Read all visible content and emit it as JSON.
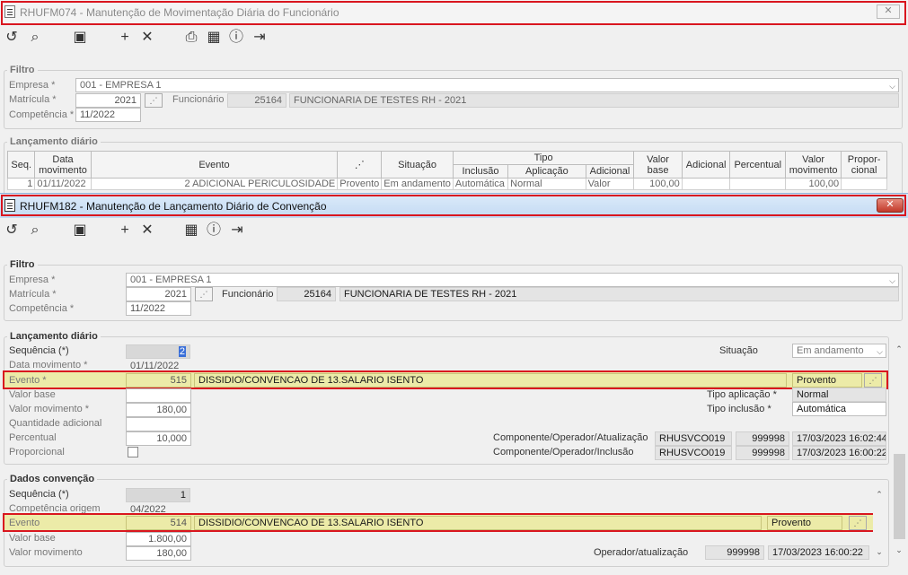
{
  "window1": {
    "title": "RHUFM074 - Manutenção de Movimentação Diária do Funcionário",
    "filtro": {
      "legend": "Filtro",
      "empresa_label": "Empresa *",
      "empresa_value": "001 - EMPRESA 1",
      "matricula_label": "Matrícula *",
      "matricula_value": "2021",
      "funcionario_label": "Funcionário",
      "funcionario_id": "25164",
      "funcionario_nome": "FUNCIONARIA DE TESTES RH - 2021",
      "competencia_label": "Competência *",
      "competencia_value": "11/2022"
    },
    "lancamento": {
      "legend": "Lançamento diário",
      "headers": {
        "seq": "Seq.",
        "data": "Data movimento",
        "evento": "Evento",
        "situacao": "Situação",
        "tipo": "Tipo",
        "inclusao": "Inclusão",
        "aplicacao": "Aplicação",
        "adicional": "Adicional",
        "valor_base": "Valor base",
        "adicional2": "Adicional",
        "percentual": "Percentual",
        "valor_mov": "Valor movimento",
        "proporcional": "Propor-cional"
      },
      "row": {
        "seq": "1",
        "data": "01/11/2022",
        "evento_cod": "2",
        "evento_nome": "ADICIONAL PERICULOSIDADE",
        "tipo_evento": "Provento",
        "situacao": "Em andamento",
        "inclusao": "Automática",
        "aplicacao": "Normal",
        "adicional": "Valor",
        "valor_base": "100,00",
        "valor_mov": "100,00"
      }
    }
  },
  "window2": {
    "title": "RHUFM182 - Manutenção de Lançamento Diário de Convenção",
    "filtro": {
      "legend": "Filtro",
      "empresa_label": "Empresa *",
      "empresa_value": "001 - EMPRESA 1",
      "matricula_label": "Matrícula *",
      "matricula_value": "2021",
      "funcionario_label": "Funcionário",
      "funcionario_id": "25164",
      "funcionario_nome": "FUNCIONARIA DE TESTES RH - 2021",
      "competencia_label": "Competência *",
      "competencia_value": "11/2022"
    },
    "lancamento": {
      "legend": "Lançamento diário",
      "sequencia_label": "Sequência (*)",
      "sequencia_value": "2",
      "data_label": "Data movimento *",
      "data_value": "01/11/2022",
      "evento_label": "Evento *",
      "evento_cod": "515",
      "evento_nome": "DISSIDIO/CONVENCAO DE 13.SALARIO ISENTO",
      "evento_tipo": "Provento",
      "valor_base_label": "Valor base",
      "valor_base_value": "",
      "valor_mov_label": "Valor movimento *",
      "valor_mov_value": "180,00",
      "qtd_label": "Quantidade adicional",
      "percentual_label": "Percentual",
      "percentual_value": "10,000",
      "proporcional_label": "Proporcional",
      "situacao_label": "Situação",
      "situacao_value": "Em andamento",
      "tipo_aplicacao_label": "Tipo aplicação *",
      "tipo_aplicacao_value": "Normal",
      "tipo_inclusao_label": "Tipo inclusão *",
      "tipo_inclusao_value": "Automática",
      "comp_atualizacao_label": "Componente/Operador/Atualização",
      "comp_atualizacao_comp": "RHUSVCO019",
      "comp_atualizacao_op": "999998",
      "comp_atualizacao_dt": "17/03/2023 16:02:44",
      "comp_inclusao_label": "Componente/Operador/Inclusão",
      "comp_inclusao_comp": "RHUSVCO019",
      "comp_inclusao_op": "999998",
      "comp_inclusao_dt": "17/03/2023 16:00:22"
    },
    "convencao": {
      "legend": "Dados convenção",
      "sequencia_label": "Sequência (*)",
      "sequencia_value": "1",
      "competencia_label": "Competência origem",
      "competencia_value": "04/2022",
      "evento_label": "Evento",
      "evento_cod": "514",
      "evento_nome": "DISSIDIO/CONVENCAO DE 13.SALARIO ISENTO",
      "evento_tipo": "Provento",
      "valor_base_label": "Valor base",
      "valor_base_value": "1.800,00",
      "valor_mov_label": "Valor movimento",
      "valor_mov_value": "180,00",
      "operador_label": "Operador/atualização",
      "operador_value": "999998",
      "operador_dt": "17/03/2023 16:00:22"
    }
  },
  "colors": {
    "highlight": "#eceba8",
    "outline": "#d9161f",
    "titlebar_active": "#cfe3f7"
  }
}
